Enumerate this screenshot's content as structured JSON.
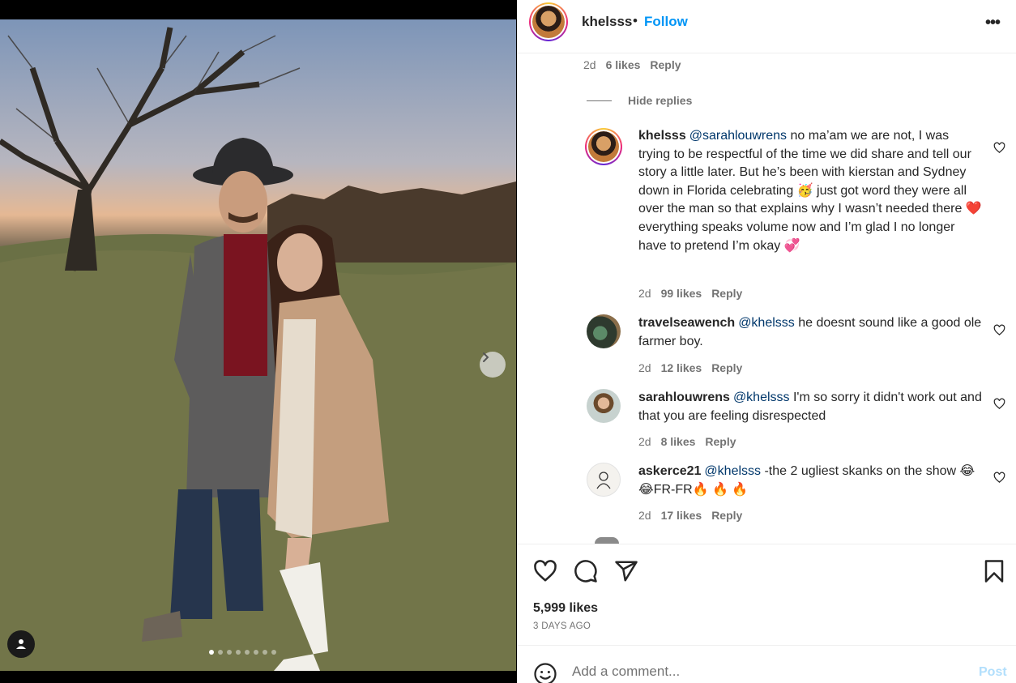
{
  "post": {
    "username": "khelsss",
    "dot": "•",
    "follow_label": "Follow",
    "more": "•••"
  },
  "first_meta": {
    "time": "2d",
    "likes": "6 likes",
    "reply": "Reply"
  },
  "hide_replies": "Hide replies",
  "comments": [
    {
      "username": "khelsss",
      "mention": "@sarahlouwrens",
      "text": "no ma’am we are not, I was trying to be respectful of the time we did share and tell our story a little later. But he’s been with kierstan and Sydney down in Florida celebrating 🥳 just got word they were all over the man so that explains why I wasn’t needed there ❤️ everything speaks volume now and I’m glad I no longer have to pretend I’m okay 💞",
      "time": "2d",
      "likes": "99 likes",
      "reply": "Reply"
    },
    {
      "username": "travelseawench",
      "mention": "@khelsss",
      "text": "he doesnt sound like a good ole farmer boy.",
      "time": "2d",
      "likes": "12 likes",
      "reply": "Reply"
    },
    {
      "username": "sarahlouwrens",
      "mention": "@khelsss",
      "text": "I'm so sorry it didn't work out and that you are feeling disrespected",
      "time": "2d",
      "likes": "8 likes",
      "reply": "Reply"
    },
    {
      "username": "askerce21",
      "mention": "@khelsss",
      "text": "-the 2 ugliest skanks on the show 😂😂FR-FR🔥 🔥 🔥",
      "time": "2d",
      "likes": "17 likes",
      "reply": "Reply"
    }
  ],
  "stats": {
    "likes": "5,999 likes",
    "date": "3 DAYS AGO"
  },
  "comment_box": {
    "placeholder": "Add a comment...",
    "post_label": "Post"
  },
  "icons": {
    "like": "heart-icon",
    "comment": "comment-icon",
    "share": "send-icon",
    "save": "bookmark-icon",
    "emoji": "smiley-icon",
    "next": "chevron-right-icon",
    "tag": "user-tag-icon"
  },
  "colors": {
    "link": "#0095f6",
    "mention": "#00376b",
    "muted": "#737373",
    "post_disabled": "#b2dffc"
  },
  "carousel": {
    "slides": 8,
    "current": 1
  }
}
